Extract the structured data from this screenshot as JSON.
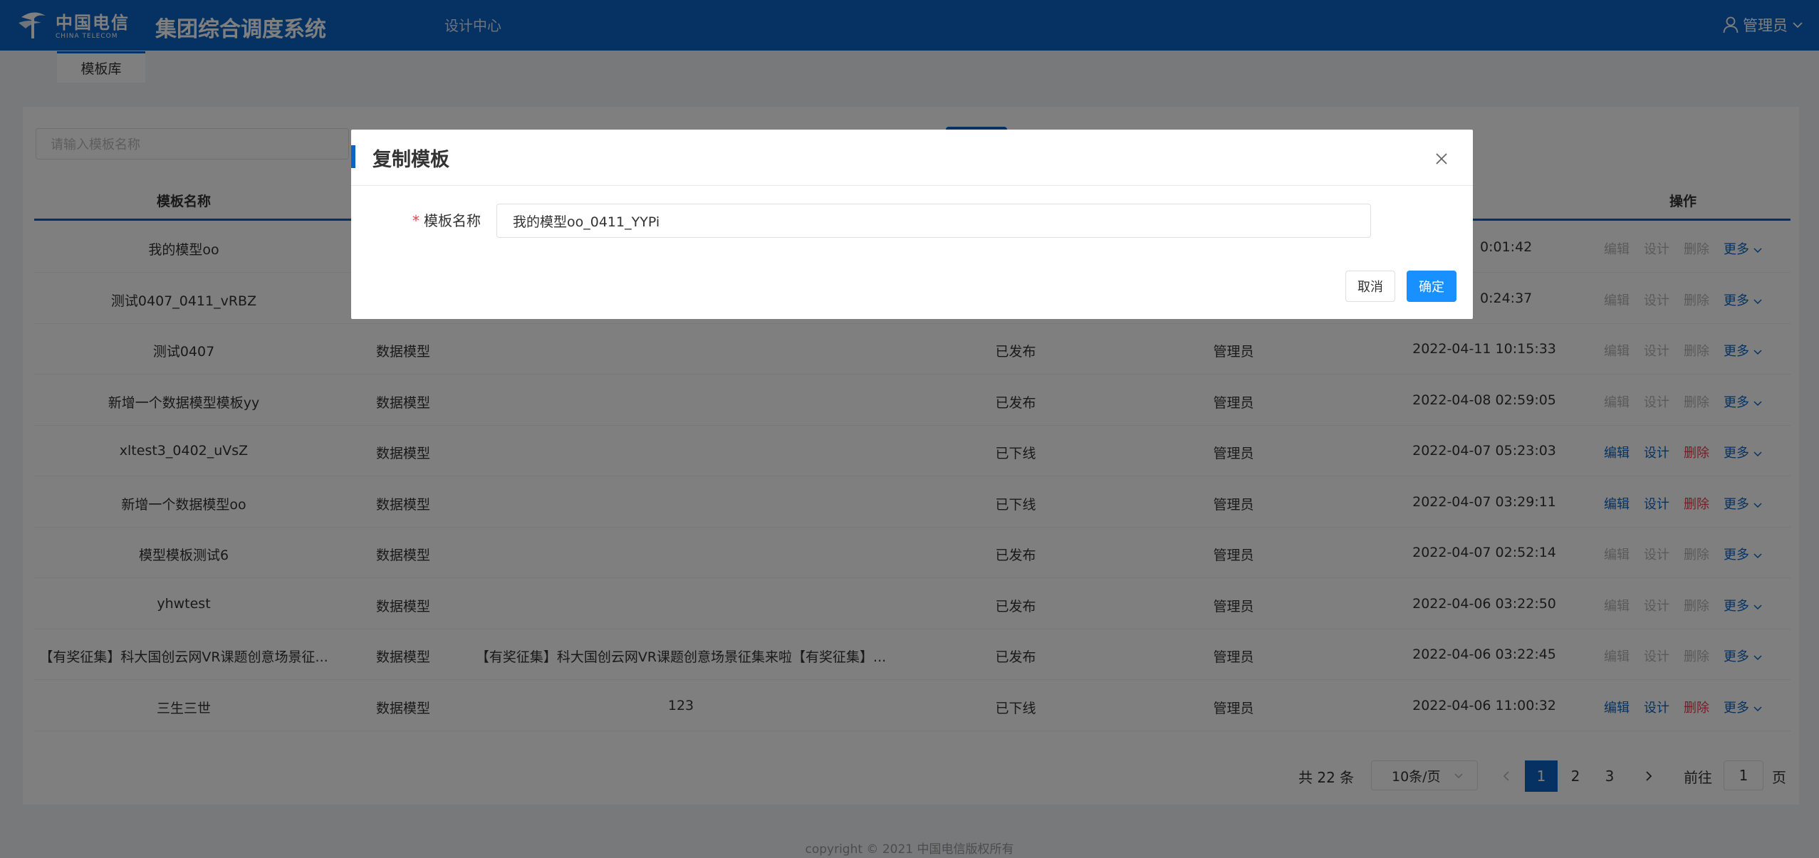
{
  "header": {
    "logo_cn": "中国电信",
    "logo_en": "CHINA TELECOM",
    "system_title": "集团综合调度系统",
    "nav_item": "设计中心",
    "user_name": "管理员"
  },
  "subtab": {
    "label": "模板库"
  },
  "search": {
    "placeholder": "请输入模板名称"
  },
  "table": {
    "headers": {
      "name": "模板名称",
      "actions": "操作"
    },
    "rows": [
      {
        "name": "我的模型oo",
        "type": "",
        "desc": "",
        "status": "",
        "creator": "",
        "time": "0:01:42",
        "ops_disabled": true
      },
      {
        "name": "测试0407_0411_vRBZ",
        "type": "",
        "desc": "",
        "status": "",
        "creator": "",
        "time": "0:24:37",
        "ops_disabled": true
      },
      {
        "name": "测试0407",
        "type": "数据模型",
        "desc": "",
        "status": "已发布",
        "creator": "管理员",
        "time": "2022-04-11 10:15:33",
        "ops_disabled": true
      },
      {
        "name": "新增一个数据模型模板yy",
        "type": "数据模型",
        "desc": "",
        "status": "已发布",
        "creator": "管理员",
        "time": "2022-04-08 02:59:05",
        "ops_disabled": true
      },
      {
        "name": "xltest3_0402_uVsZ",
        "type": "数据模型",
        "desc": "",
        "status": "已下线",
        "creator": "管理员",
        "time": "2022-04-07 05:23:03",
        "ops_disabled": false
      },
      {
        "name": "新增一个数据模型oo",
        "type": "数据模型",
        "desc": "",
        "status": "已下线",
        "creator": "管理员",
        "time": "2022-04-07 03:29:11",
        "ops_disabled": false
      },
      {
        "name": "模型模板测试6",
        "type": "数据模型",
        "desc": "",
        "status": "已发布",
        "creator": "管理员",
        "time": "2022-04-07 02:52:14",
        "ops_disabled": true
      },
      {
        "name": "yhwtest",
        "type": "数据模型",
        "desc": "",
        "status": "已发布",
        "creator": "管理员",
        "time": "2022-04-06 03:22:50",
        "ops_disabled": true
      },
      {
        "name": "【有奖征集】科大国创云网VR课题创意场景征...",
        "type": "数据模型",
        "desc": "【有奖征集】科大国创云网VR课题创意场景征集来啦【有奖征集】...",
        "status": "已发布",
        "creator": "管理员",
        "time": "2022-04-06 03:22:45",
        "ops_disabled": true
      },
      {
        "name": "三生三世",
        "type": "数据模型",
        "desc": "123",
        "status": "已下线",
        "creator": "管理员",
        "time": "2022-04-06 11:00:32",
        "ops_disabled": false
      }
    ],
    "op_labels": {
      "edit": "编辑",
      "design": "设计",
      "delete": "删除",
      "more": "更多"
    }
  },
  "pagination": {
    "total_text": "共 22 条",
    "page_size": "10条/页",
    "pages": [
      "1",
      "2",
      "3"
    ],
    "active_page": "1",
    "goto_label": "前往",
    "goto_value": "1",
    "page_unit": "页"
  },
  "footer": {
    "copyright": "copyright © 2021 中国电信版权所有"
  },
  "dialog": {
    "title": "复制模板",
    "field_label": "模板名称",
    "field_required_mark": "*",
    "field_value": "我的模型oo_0411_YYPi",
    "cancel_label": "取消",
    "confirm_label": "确定"
  },
  "colors": {
    "brand_blue": "#0a64c4",
    "primary_button": "#1890ff",
    "danger": "#e3404c"
  }
}
